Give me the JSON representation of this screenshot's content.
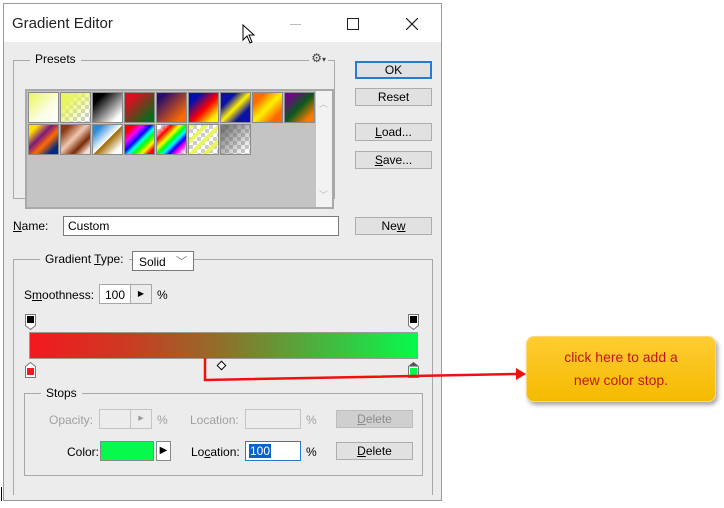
{
  "window": {
    "title": "Gradient Editor",
    "minimize_icon": "minimize-icon",
    "maximize_icon": "maximize-icon",
    "close_icon": "close-icon"
  },
  "presets": {
    "label": "Presets",
    "menu_icon": "gear-icon",
    "swatches": [
      {
        "name": "foreground-to-background",
        "bg": "linear-gradient(135deg,#e9f55a,#fbfde6 60%,#fff)"
      },
      {
        "name": "foreground-to-transparent",
        "bg": "linear-gradient(135deg,#e9f55a 20%,rgba(233,245,90,0) 90%),repeating-conic-gradient(#ccc 0 25%,#fff 0 50%) 0 0/8px 8px"
      },
      {
        "name": "black-white",
        "bg": "linear-gradient(135deg,#000 20%,#fff 85%)"
      },
      {
        "name": "red-green",
        "bg": "linear-gradient(135deg,#d81020 20%,#0b6a1b 85%)"
      },
      {
        "name": "violet-orange",
        "bg": "linear-gradient(135deg,#2a0c6a 15%,#ff6a00 85%)"
      },
      {
        "name": "blue-red-yellow",
        "bg": "linear-gradient(135deg,#0010b0 20%,#ff0000 55%,#fff200 85%)"
      },
      {
        "name": "blue-yellow-blue",
        "bg": "linear-gradient(135deg,#0a10a8 25%,#fff000 50%,#0a10a8 75%)"
      },
      {
        "name": "orange-yellow-orange",
        "bg": "linear-gradient(135deg,#ff6a00 20%,#fff200 50%,#ff6a00 80%)"
      },
      {
        "name": "violet-green-orange",
        "bg": "linear-gradient(135deg,#6a0a80 15%,#0b5a1b 50%,#ff7a00 85%)"
      },
      {
        "name": "yellow-violet-orange-blue",
        "bg": "linear-gradient(135deg,#ffe000 15%,#7a1a80 40%,#ff6a00 60%,#002a80 85%)"
      },
      {
        "name": "copper",
        "bg": "linear-gradient(135deg,#8a3a10 15%,#f0c8b0 45%,#7a2a08 70%,#f4e0d4 90%)"
      },
      {
        "name": "chrome",
        "bg": "linear-gradient(135deg,#2a8ad8 15%,#ffffff 50%,#a06a00 52%,#fff 85%)"
      },
      {
        "name": "spectrum",
        "bg": "linear-gradient(135deg,#ff0000 15%,#ff00ff 30%,#0000ff 45%,#00ffff 55%,#00ff00 65%,#ffff00 78%,#ff0000 90%)"
      },
      {
        "name": "transparent-rainbow",
        "bg": "linear-gradient(135deg,rgba(255,0,0,0) 10%,#ff0000 25%,#ffff00 40%,#00ff00 50%,#00ffff 60%,#0000ff 70%,#ff00ff 80%,rgba(255,0,255,0) 95%),repeating-conic-gradient(#ccc 0 25%,#fff 0 50%) 0 0/8px 8px"
      },
      {
        "name": "transparent-stripes",
        "bg": "repeating-linear-gradient(135deg,#e9f55a 0 4px,rgba(255,255,255,0) 4px 10px),repeating-conic-gradient(#ccc 0 25%,#fff 0 50%) 0 0/8px 8px"
      },
      {
        "name": "neutral-density",
        "bg": "linear-gradient(135deg,rgba(90,90,90,.8) 10%,rgba(90,90,90,0) 90%),repeating-conic-gradient(#ccc 0 25%,#fff 0 50%) 0 0/8px 8px"
      }
    ]
  },
  "buttons": {
    "ok": "OK",
    "reset": "Reset",
    "load_pre": "L",
    "load_post": "oad...",
    "save_pre": "S",
    "save_post": "ave...",
    "new_pre": "Ne",
    "new_u": "w"
  },
  "name_field": {
    "label_u": "N",
    "label_rest": "ame:",
    "value": "Custom"
  },
  "gradient_type": {
    "label_pre": "Gradient ",
    "label_u": "T",
    "label_post": "ype:",
    "value": "Solid"
  },
  "smoothness": {
    "label_pre": "S",
    "label_u": "m",
    "label_post": "oothness:",
    "value": "100",
    "unit": "%"
  },
  "gradient": {
    "start_color": "#f41820",
    "end_color": "#06fa4c",
    "opacity_stops": [
      "#000000",
      "#000000"
    ],
    "color_stops": [
      "#f41820",
      "#06fa4c"
    ],
    "selected_stop_location_percent": 100
  },
  "stops": {
    "label": "Stops",
    "opacity_label": "Opacity:",
    "opacity_unit": "%",
    "opacity_location_label": "Location:",
    "opacity_location_unit": "%",
    "delete_pre": "D",
    "delete_post": "elete",
    "color_label": "Color:",
    "color_value": "#06fa4c",
    "color_location_label_pre": "Lo",
    "color_location_label_u": "c",
    "color_location_label_post": "ation:",
    "color_location_value": "100",
    "color_location_unit": "%"
  },
  "callout": {
    "line1": "click here to add a",
    "line2": "new color stop."
  }
}
